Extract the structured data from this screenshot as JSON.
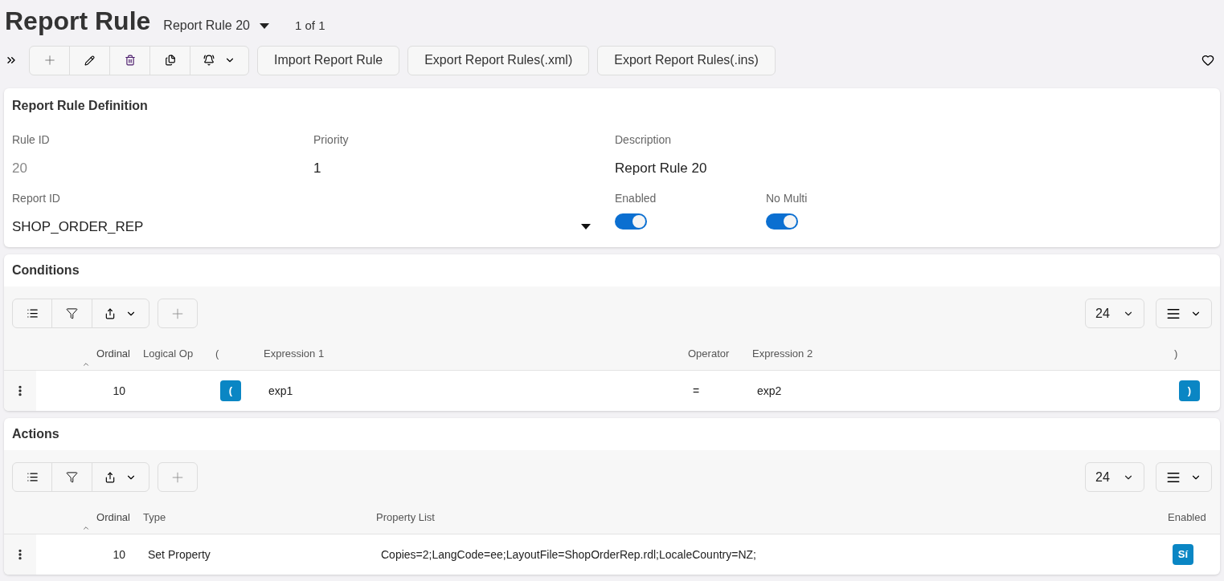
{
  "header": {
    "title": "Report Rule",
    "record": "Report Rule 20",
    "count": "1 of 1"
  },
  "toolbar": {
    "buttons": [
      "Import Report Rule",
      "Export Report Rules(.xml)",
      "Export Report Rules(.ins)"
    ]
  },
  "definition": {
    "title": "Report Rule Definition",
    "fields": [
      {
        "kind": "readonly",
        "label": "Rule ID",
        "value": "20"
      },
      {
        "kind": "text",
        "label": "Priority",
        "value": "1"
      },
      {
        "kind": "text",
        "label": "Description",
        "value": "Report Rule 20"
      },
      {
        "kind": "select",
        "label": "Report ID",
        "value": "SHOP_ORDER_REP"
      },
      {
        "kind": "toggle",
        "label": "Enabled",
        "on": true
      },
      {
        "kind": "toggle",
        "label": "No Multi",
        "on": true
      }
    ]
  },
  "conditions": {
    "title": "Conditions",
    "page_size": "24",
    "columns": [
      {
        "label": "Ordinal",
        "sorted": true
      },
      {
        "label": "Logical Op",
        "sorted": false
      },
      {
        "label": "(",
        "sorted": false
      },
      {
        "label": "Expression 1",
        "sorted": false
      },
      {
        "label": "Operator",
        "sorted": false
      },
      {
        "label": "Expression 2",
        "sorted": false
      },
      {
        "label": ")",
        "sorted": false
      }
    ],
    "rows": [
      {
        "cells": [
          {
            "kind": "text",
            "text": "10"
          },
          {
            "kind": "text",
            "text": ""
          },
          {
            "kind": "badge",
            "text": "("
          },
          {
            "kind": "text",
            "text": "exp1"
          },
          {
            "kind": "text",
            "text": "="
          },
          {
            "kind": "text",
            "text": "exp2"
          },
          {
            "kind": "badge",
            "text": ")"
          }
        ]
      }
    ]
  },
  "actions": {
    "title": "Actions",
    "page_size": "24",
    "columns": [
      {
        "label": "Ordinal",
        "sorted": true
      },
      {
        "label": "Type",
        "sorted": false
      },
      {
        "label": "Property List",
        "sorted": false
      },
      {
        "label": "Enabled",
        "sorted": false
      }
    ],
    "rows": [
      {
        "cells": [
          {
            "kind": "text",
            "text": "10"
          },
          {
            "kind": "text",
            "text": "Set Property"
          },
          {
            "kind": "text",
            "text": "Copies=2;LangCode=ee;LayoutFile=ShopOrderRep.rdl;LocaleCountry=NZ;"
          },
          {
            "kind": "badge",
            "text": "Sí"
          }
        ]
      }
    ]
  }
}
